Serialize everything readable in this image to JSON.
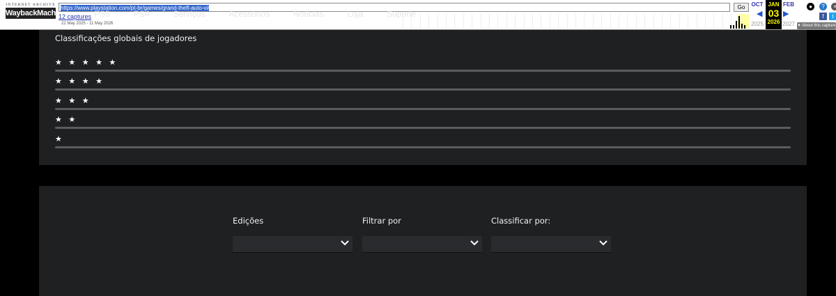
{
  "wayback": {
    "logo_top": "INTERNET ARCHIVE",
    "logo_main": "WaybackMachine",
    "url": "https://www.playstation.com/pt-br/games/grand-theft-auto-vi/",
    "go_label": "Go",
    "captures": "12 captures",
    "range": "22 May 2025 - 11 May 2026",
    "prev_month": "OCT",
    "prev_year": "2025",
    "cur_month": "JAN",
    "cur_day": "03",
    "cur_year": "2026",
    "next_month": "FEB",
    "next_year": "2027",
    "about": "About this capture",
    "bg_nav": [
      "PS5",
      "PS4",
      "Serviços",
      "Acessórios",
      "Notícias",
      "Loja",
      "Suporte"
    ],
    "spark_bars": [
      0.3,
      0.3,
      0.6,
      1.0,
      0.4,
      0.3
    ]
  },
  "ratings": {
    "title": "Classificações globais de jogadores",
    "rows": [
      {
        "stars": "★ ★ ★ ★ ★",
        "fraction": 0
      },
      {
        "stars": "★ ★ ★ ★",
        "fraction": 0
      },
      {
        "stars": "★ ★ ★",
        "fraction": 0
      },
      {
        "stars": "★ ★",
        "fraction": 0
      },
      {
        "stars": "★",
        "fraction": 0
      }
    ]
  },
  "filters": {
    "editions_label": "Edições",
    "filter_label": "Filtrar por",
    "sort_label": "Classificar por:",
    "editions_value": "",
    "filter_value": "",
    "sort_value": ""
  },
  "icons": {
    "chevron": "chevron-down-icon",
    "help": "help-icon",
    "user": "user-icon",
    "facebook": "facebook-icon",
    "twitter": "twitter-icon"
  }
}
